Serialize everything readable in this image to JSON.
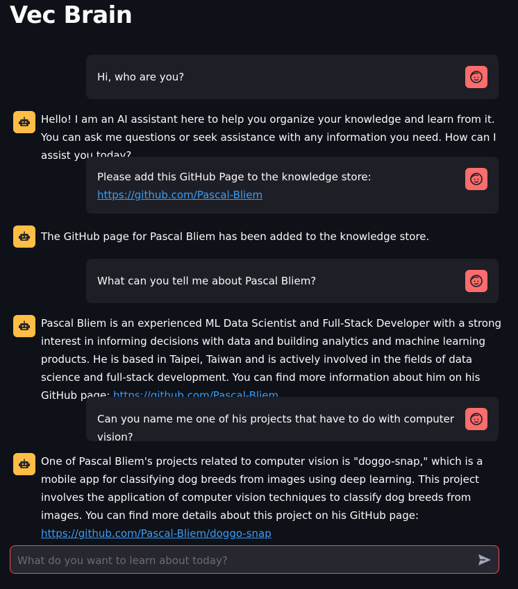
{
  "app": {
    "title": "Vec Brain"
  },
  "messages": {
    "m1": {
      "role": "user",
      "text": "Hi, who are you?"
    },
    "m2": {
      "role": "assistant",
      "text": "Hello! I am an AI assistant here to help you organize your knowledge and learn from it. You can ask me questions or seek assistance with any information you need. How can I assist you today?"
    },
    "m3": {
      "role": "user",
      "text": "Please add this GitHub Page to the knowledge store: ",
      "link": "https://github.com/Pascal-Bliem"
    },
    "m4": {
      "role": "assistant",
      "text": "The GitHub page for Pascal Bliem has been added to the knowledge store."
    },
    "m5": {
      "role": "user",
      "text": "What can you tell me about Pascal Bliem?"
    },
    "m6": {
      "role": "assistant",
      "text": "Pascal Bliem is an experienced ML Data Scientist and Full-Stack Developer with a strong interest in informing decisions with data and building analytics and machine learning products. He is based in Taipei, Taiwan and is actively involved in the fields of data science and full-stack development. You can find more information about him on his GitHub page: ",
      "link": "https://github.com/Pascal-Bliem"
    },
    "m7": {
      "role": "user",
      "text": "Can you name me one of his projects that have to do with computer vision?"
    },
    "m8": {
      "role": "assistant",
      "text": "One of Pascal Bliem's projects related to computer vision is \"doggo-snap,\" which is a mobile app for classifying dog breeds from images using deep learning. This project involves the application of computer vision techniques to classify dog breeds from images. You can find more details about this project on his GitHub page: ",
      "link": "https://github.com/Pascal-Bliem/doggo-snap"
    }
  },
  "chat_input": {
    "placeholder": "What do you want to learn about today?",
    "value": ""
  },
  "icons": {
    "user_avatar": "user-face-icon",
    "assistant_avatar": "robot-icon",
    "send": "send-icon"
  },
  "colors": {
    "user_avatar": "#ff6c6c",
    "assistant_avatar": "#ffbd45",
    "link": "#3c9df8",
    "input_border": "#ff4b4b"
  }
}
